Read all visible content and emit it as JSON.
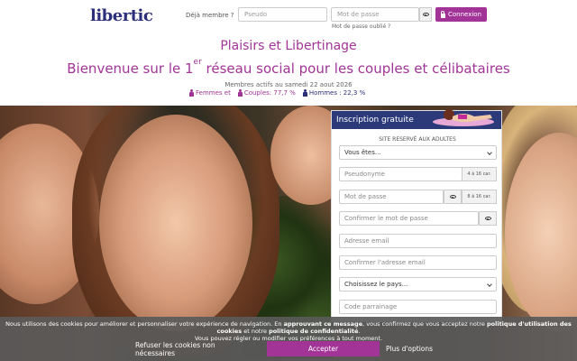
{
  "header": {
    "logo": "libertic",
    "already_member": "Déjà membre ?",
    "pseudo_placeholder": "Pseudo",
    "password_placeholder": "Mot de passe",
    "login_label": "Connexion",
    "forgot_label": "Mot de passe oublié ?"
  },
  "hero": {
    "title": "Plaisirs et Libertinage",
    "subtitle_pre": "Bienvenue sur le 1",
    "subtitle_sup": "er",
    "subtitle_post": " réseau social pour les couples et célibataires",
    "members_active": "Membres actifs au samedi 22 aout 2026",
    "stats": [
      {
        "label": "Femmes et",
        "color": "#a23497"
      },
      {
        "label": "Couples: 77,7 %",
        "color": "#a23497"
      },
      {
        "label": "Hommes : 22,3 %",
        "color": "#2c2f7a"
      }
    ]
  },
  "form": {
    "title": "Inscription gratuite",
    "adults_only": "SITE RESERVÉ AUX ADULTES",
    "you_are": "Vous êtes...",
    "pseudonyme": "Pseudonyme",
    "pseudo_hint": "4 à 16 car.",
    "password": "Mot de passe",
    "password_hint": "8 à 16 car.",
    "confirm_password": "Confirmer le mot de passe",
    "email": "Adresse email",
    "confirm_email": "Confirmer l'adresse email",
    "country": "Choisissez le pays...",
    "code": "Code parrainage"
  },
  "cookie": {
    "t1": "Nous utilisons des cookies pour améliorer et personnaliser votre expérience de navigation. En ",
    "t2": "approuvant ce message",
    "t3": ", vous confirmez que vous acceptez notre ",
    "t4": "politique d'utilisation des cookies",
    "t5": " et notre ",
    "t6": "politique de confidentialité",
    "t7": ".",
    "t8": "Vous pouvez régler ou modifier vos préférences à tout moment.",
    "refuse": "Refuser les cookies non nécessaires",
    "accept": "Accepter",
    "more": "Plus d'options"
  },
  "colors": {
    "brand_purple": "#a23497",
    "brand_navy": "#2c2f7a",
    "panel_head": "#2c3a7a"
  }
}
